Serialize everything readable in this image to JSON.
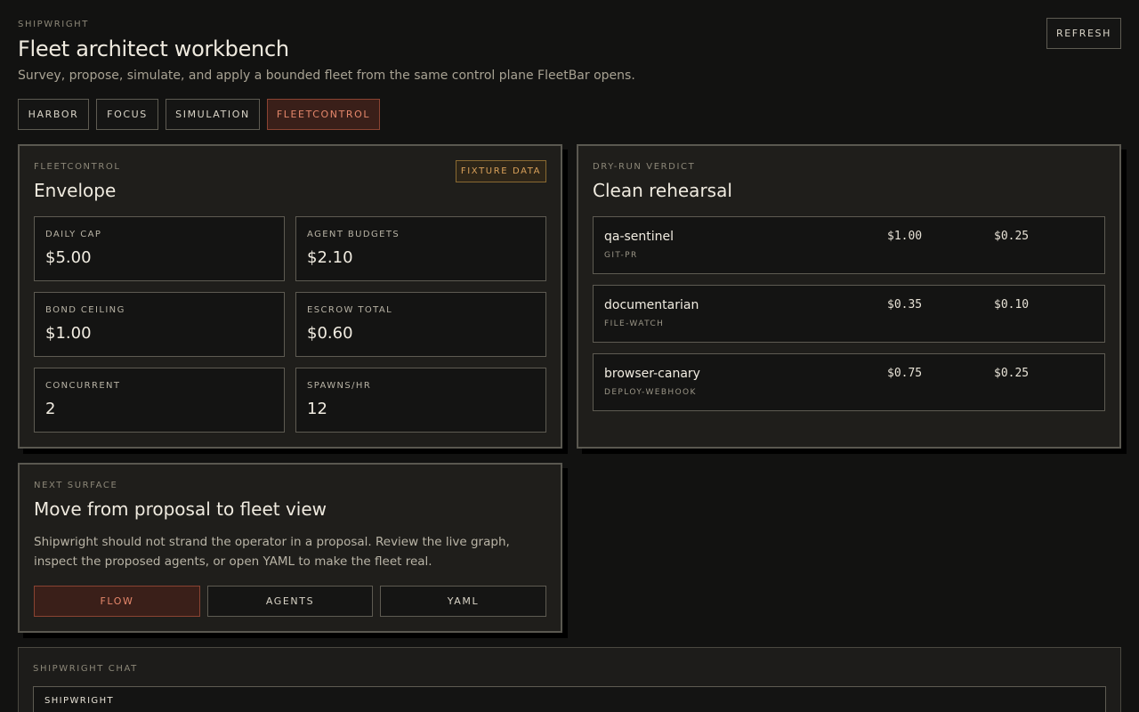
{
  "header": {
    "eyebrow": "SHIPWRIGHT",
    "title": "Fleet architect workbench",
    "subtitle": "Survey, propose, simulate, and apply a bounded fleet from the same control plane FleetBar opens.",
    "refresh_label": "REFRESH"
  },
  "tabs": [
    {
      "label": "HARBOR",
      "active": false
    },
    {
      "label": "FOCUS",
      "active": false
    },
    {
      "label": "SIMULATION",
      "active": false
    },
    {
      "label": "FLEETCONTROL",
      "active": true
    }
  ],
  "envelope": {
    "eyebrow": "FLEETCONTROL",
    "title": "Envelope",
    "badge": "FIXTURE DATA",
    "stats": [
      {
        "label": "DAILY CAP",
        "value": "$5.00"
      },
      {
        "label": "AGENT BUDGETS",
        "value": "$2.10"
      },
      {
        "label": "BOND CEILING",
        "value": "$1.00"
      },
      {
        "label": "ESCROW TOTAL",
        "value": "$0.60"
      },
      {
        "label": "CONCURRENT",
        "value": "2"
      },
      {
        "label": "SPAWNS/HR",
        "value": "12"
      }
    ]
  },
  "verdict": {
    "eyebrow": "DRY-RUN VERDICT",
    "title": "Clean rehearsal",
    "agents": [
      {
        "name": "qa-sentinel",
        "trigger": "GIT-PR",
        "budget": "$1.00",
        "bond": "$0.25"
      },
      {
        "name": "documentarian",
        "trigger": "FILE-WATCH",
        "budget": "$0.35",
        "bond": "$0.10"
      },
      {
        "name": "browser-canary",
        "trigger": "DEPLOY-WEBHOOK",
        "budget": "$0.75",
        "bond": "$0.25"
      }
    ]
  },
  "next_surface": {
    "eyebrow": "NEXT SURFACE",
    "title": "Move from proposal to fleet view",
    "body": "Shipwright should not strand the operator in a proposal. Review the live graph, inspect the proposed agents, or open YAML to make the fleet real.",
    "buttons": [
      {
        "label": "FLOW",
        "active": true
      },
      {
        "label": "AGENTS",
        "active": false
      },
      {
        "label": "YAML",
        "active": false
      }
    ]
  },
  "chat": {
    "eyebrow": "SHIPWRIGHT CHAT",
    "speaker": "SHIPWRIGHT"
  },
  "colors": {
    "background": "#121211",
    "accent": "#e5876b",
    "accent_bg": "#3a1f19",
    "badge": "#d9a15a"
  }
}
